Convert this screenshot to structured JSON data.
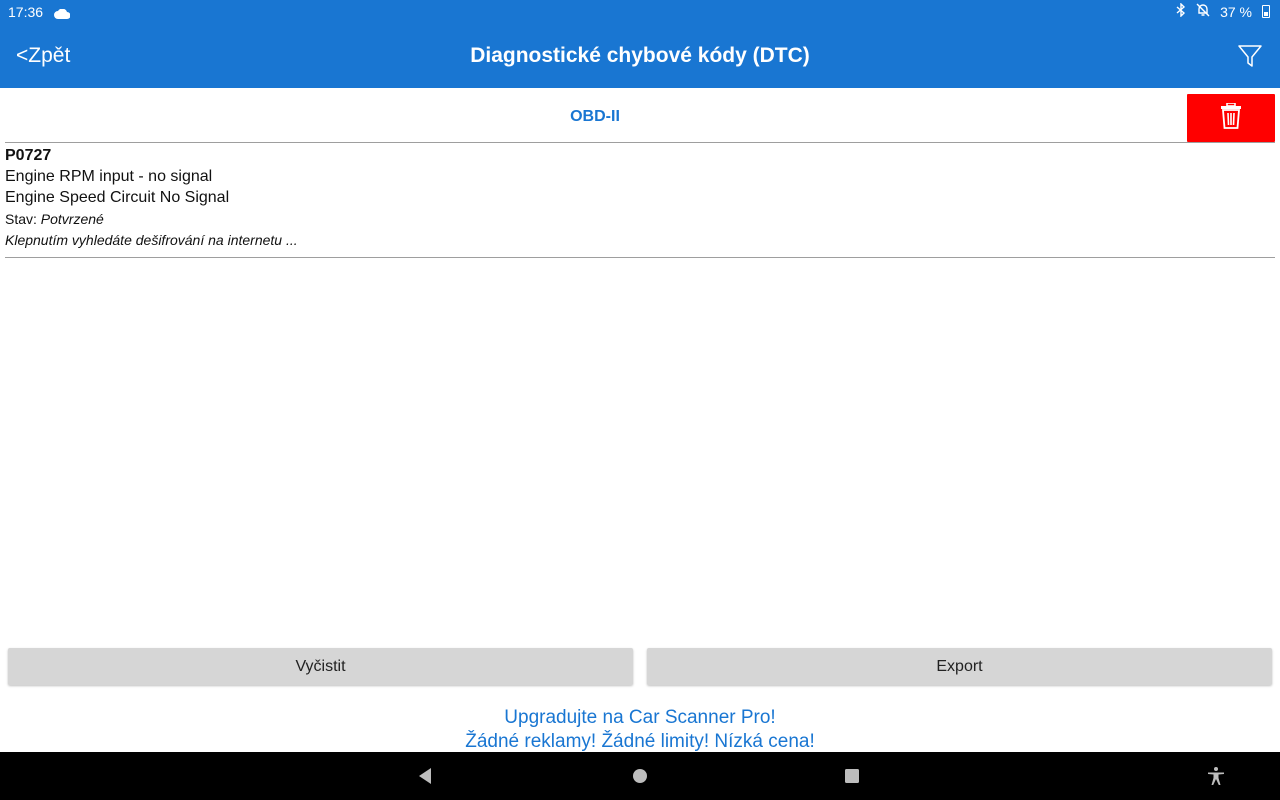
{
  "status_bar": {
    "time": "17:36",
    "battery": "37 %",
    "icons": [
      "cloud-icon",
      "bluetooth-icon",
      "notifications-off-icon",
      "battery-icon"
    ]
  },
  "app_bar": {
    "back_label": "<Zpět",
    "title": "Diagnostické chybové kódy (DTC)",
    "filter_icon": "filter-icon",
    "color": "#1976d2"
  },
  "section": {
    "label": "OBD-II",
    "delete_icon": "trash-icon",
    "delete_color": "#ff0000"
  },
  "dtc_list": [
    {
      "code": "P0727",
      "desc1": "Engine RPM input - no signal",
      "desc2": "Engine Speed Circuit No Signal",
      "status_label": "Stav: ",
      "status_value": "Potvrzené",
      "hint": "Klepnutím vyhledáte dešifrování na internetu ..."
    }
  ],
  "buttons": {
    "clear_label": "Vyčistit",
    "export_label": "Export"
  },
  "promo": {
    "line1": "Upgradujte na Car Scanner Pro!",
    "line2": "Žádné reklamy! Žádné limity! Nízká cena!"
  },
  "nav_bar": {
    "icons": [
      "back-triangle-icon",
      "home-circle-icon",
      "recents-square-icon",
      "accessibility-icon"
    ]
  }
}
